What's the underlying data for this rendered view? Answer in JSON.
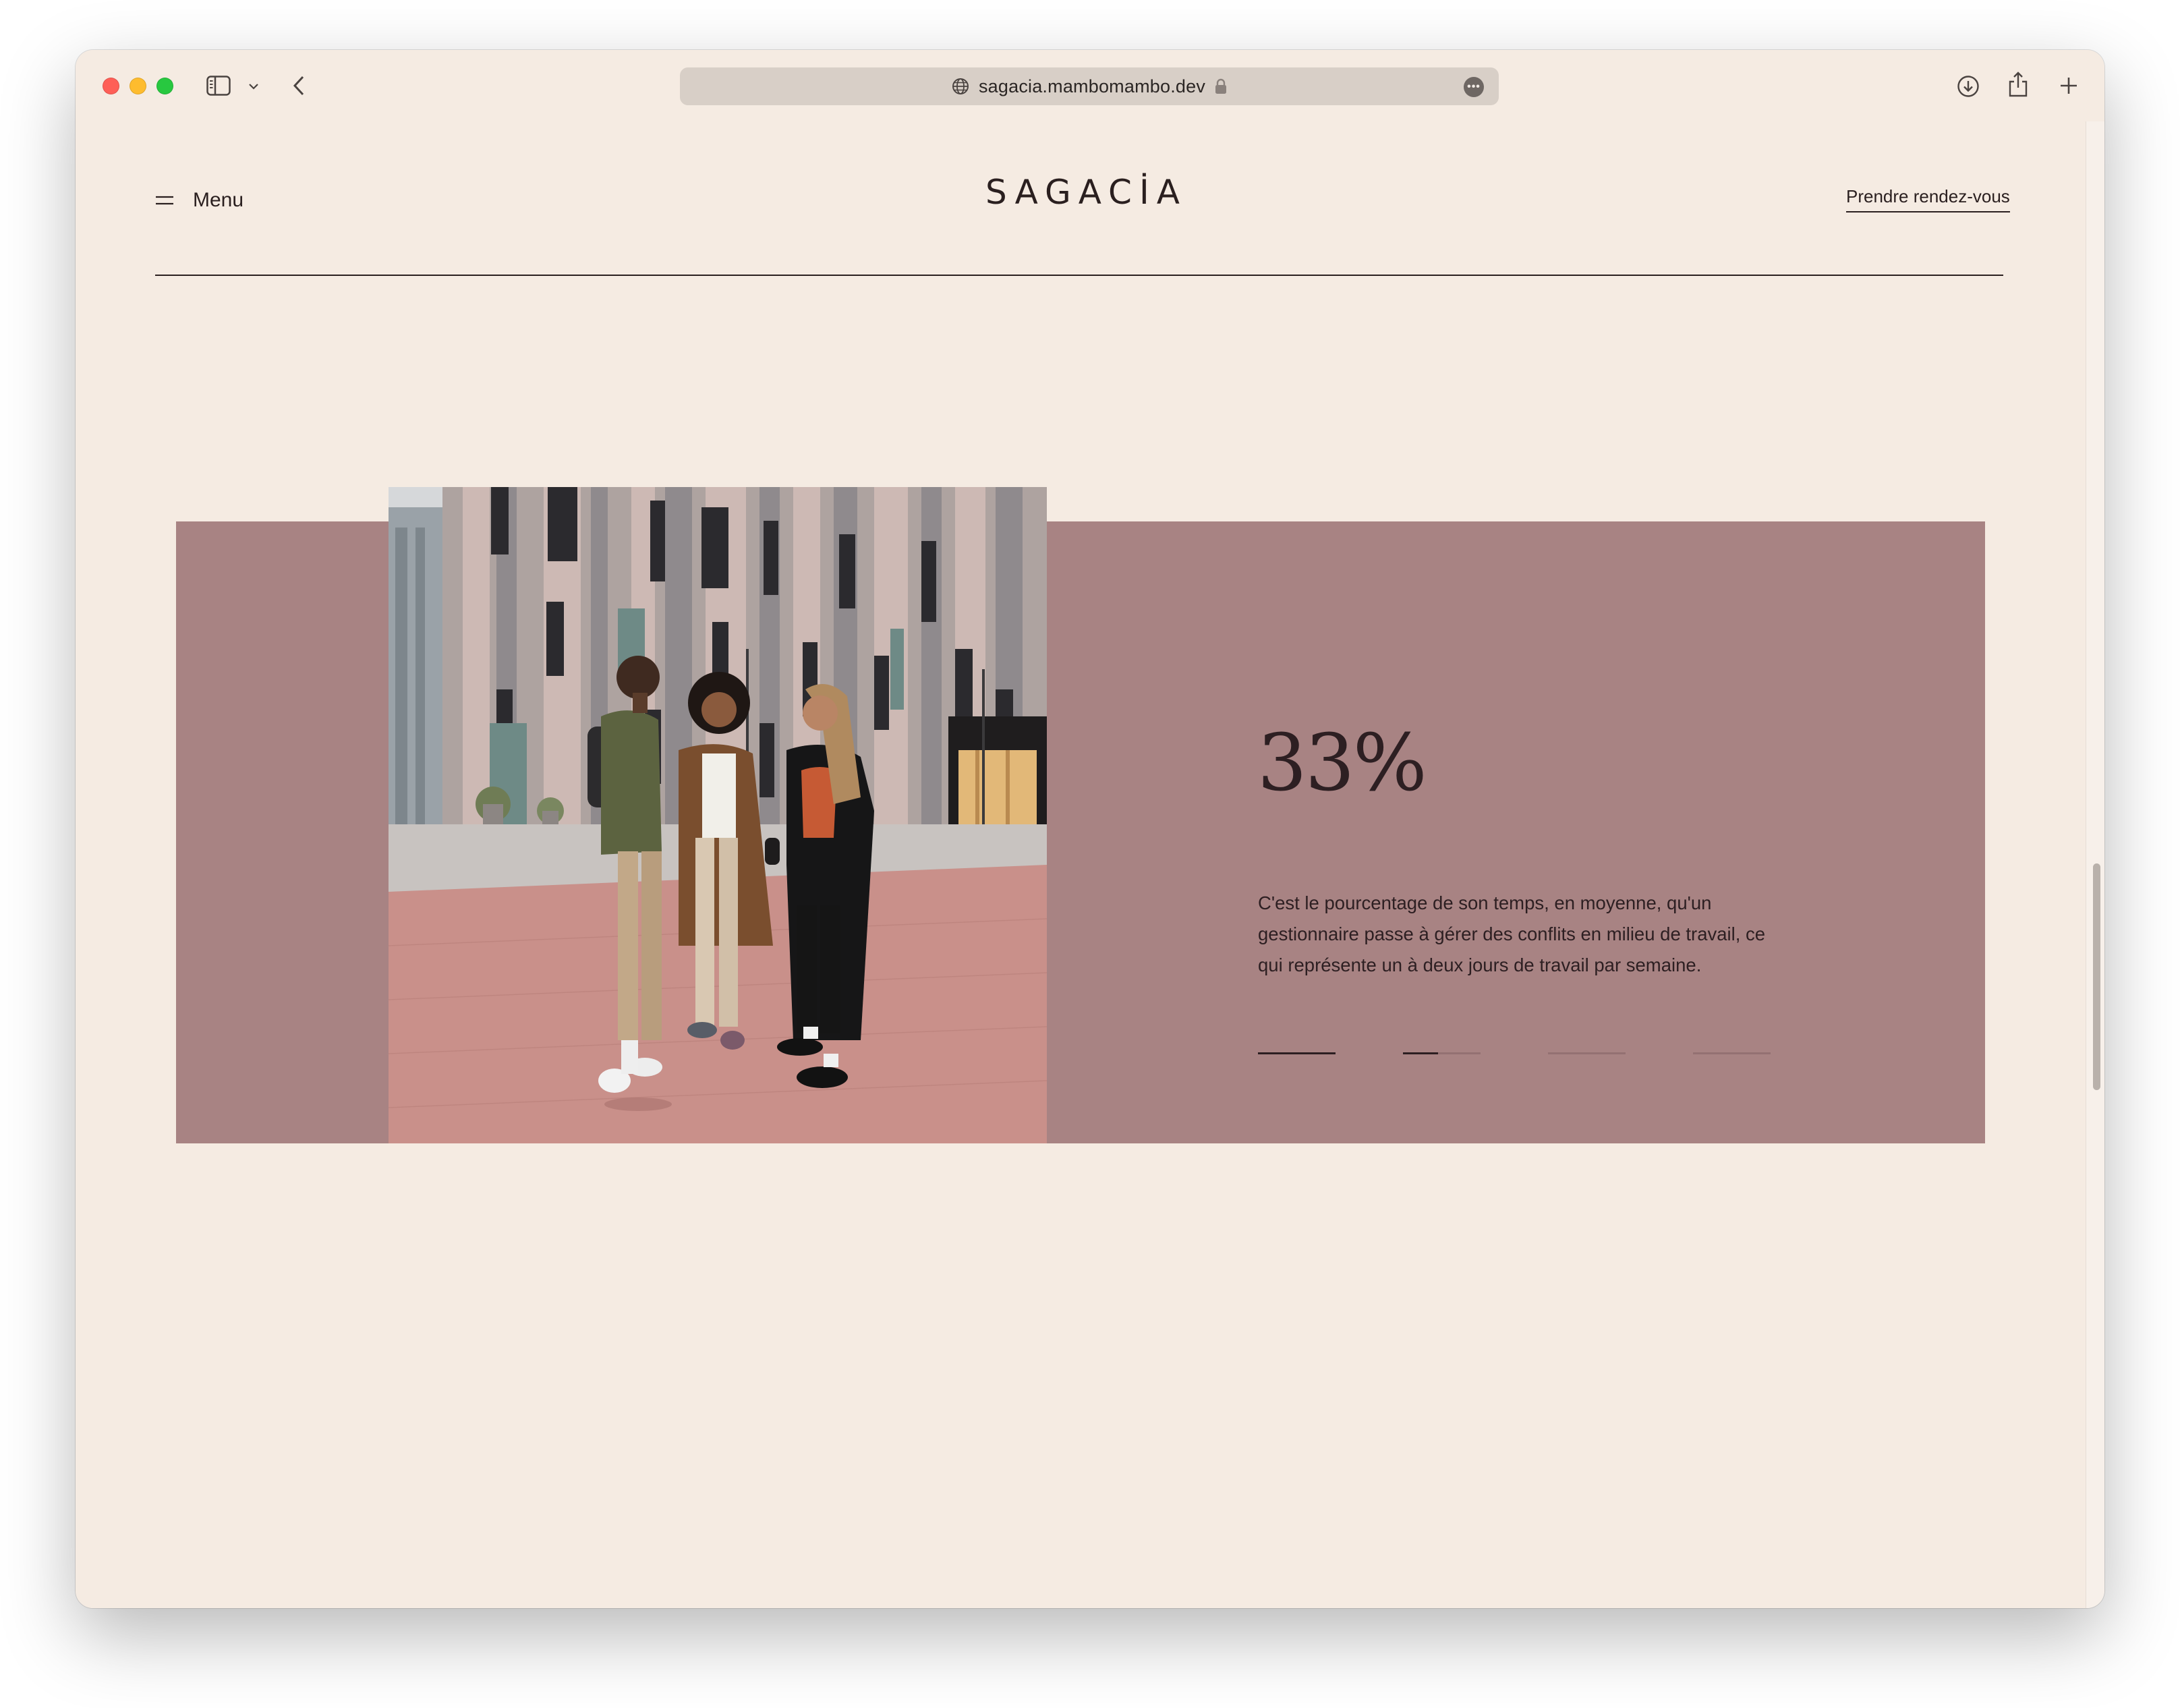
{
  "browser": {
    "url": "sagacia.mambomambo.dev",
    "url_icons": {
      "site": "globe-icon",
      "secure": "lock-icon",
      "more": "ellipsis-icon"
    },
    "toolbar_icons": [
      "sidebar-icon",
      "chevron-down-icon",
      "back-chevron-icon",
      "download-icon",
      "share-icon",
      "plus-icon"
    ]
  },
  "header": {
    "menu_label": "Menu",
    "menu_icon": "hamburger-icon",
    "logo": "SAGACİA",
    "cta_label": "Prendre rendez-vous"
  },
  "stat_block": {
    "value": "33%",
    "description": "C'est le pourcentage de son temps, en moyenne, qu'un gestionnaire passe à gérer des conflits en milieu de travail, ce qui représente un à deux jours de travail par semaine.",
    "slides": [
      {
        "progress": 1.0
      },
      {
        "progress": 0.45
      },
      {
        "progress": 0
      },
      {
        "progress": 0
      }
    ]
  },
  "colors": {
    "background": "#f5ebe2",
    "panel": "#a88383",
    "text": "#2a1f1f",
    "urlbar": "#d8cfc7"
  }
}
